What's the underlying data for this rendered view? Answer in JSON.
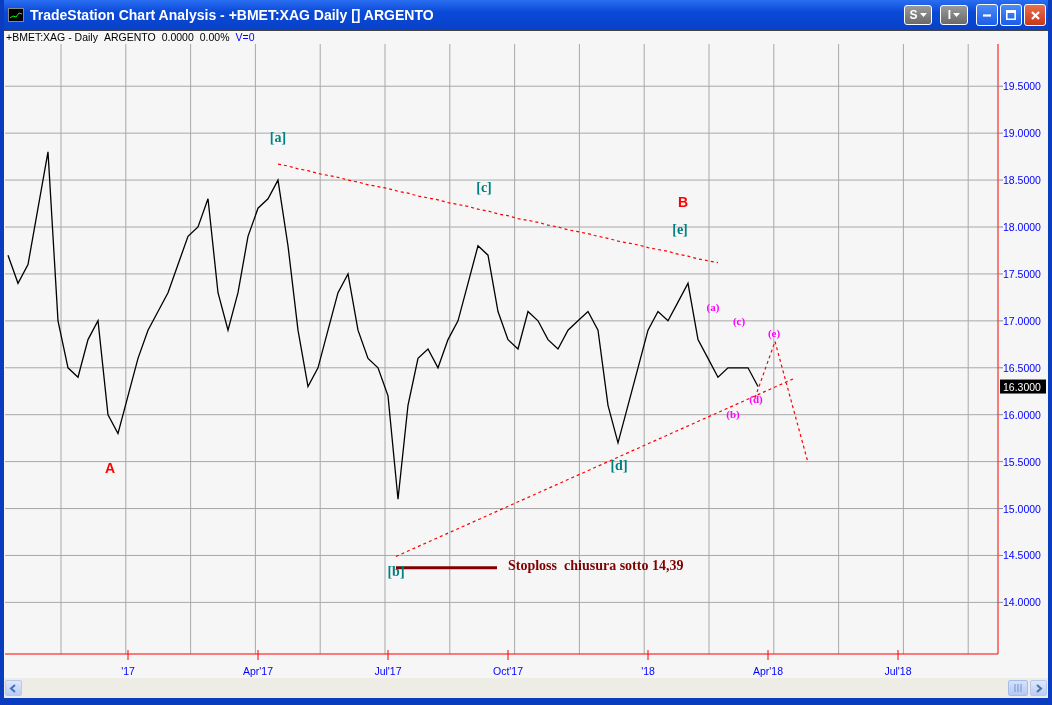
{
  "window": {
    "title": "TradeStation Chart Analysis - +BMET:XAG Daily [] ARGENTO",
    "toolbar_buttons": [
      "S",
      "I"
    ]
  },
  "chart_header": {
    "symbol": "+BMET:XAG - Daily",
    "name": "ARGENTO",
    "price": "0.0000",
    "change": "0.00%",
    "volume": "V=0"
  },
  "last_price": "16.3000",
  "chart_data": {
    "type": "line",
    "grid": true,
    "categories": [
      null,
      null,
      null,
      null,
      null,
      null,
      null,
      null,
      null,
      null,
      null,
      null,
      "'17",
      null,
      null,
      null,
      null,
      null,
      null,
      null,
      null,
      null,
      null,
      null,
      null,
      "Apr'17",
      null,
      null,
      null,
      null,
      null,
      null,
      null,
      null,
      null,
      null,
      null,
      null,
      "Jul'17",
      null,
      null,
      null,
      null,
      null,
      null,
      null,
      null,
      null,
      null,
      null,
      "Oct'17",
      null,
      null,
      null,
      null,
      null,
      null,
      null,
      null,
      null,
      null,
      null,
      null,
      null,
      "'18",
      null,
      null,
      null,
      null,
      null,
      null,
      null,
      null,
      null,
      null,
      null,
      "Apr'18",
      null,
      null,
      null,
      null,
      null,
      null,
      null,
      null,
      null,
      null,
      null,
      null,
      "Jul'18",
      null,
      null,
      null,
      null,
      null,
      null,
      null,
      null,
      null,
      null
    ],
    "series": [
      {
        "color": "#000000",
        "line_style": "solid",
        "values": [
          17.7,
          17.4,
          17.6,
          18.2,
          18.8,
          17.0,
          16.5,
          16.4,
          16.8,
          17.0,
          16.0,
          15.8,
          16.2,
          16.6,
          16.9,
          17.1,
          17.3,
          17.6,
          17.9,
          18.0,
          18.3,
          17.3,
          16.9,
          17.3,
          17.9,
          18.2,
          18.3,
          18.5,
          17.8,
          16.9,
          16.3,
          16.5,
          16.9,
          17.3,
          17.5,
          16.9,
          16.6,
          16.5,
          16.2,
          15.1,
          16.1,
          16.6,
          16.7,
          16.5,
          16.8,
          17.0,
          17.4,
          17.8,
          17.7,
          17.1,
          16.8,
          16.7,
          17.1,
          17.0,
          16.8,
          16.7,
          16.9,
          17.0,
          17.1,
          16.9,
          16.1,
          15.7,
          16.1,
          16.5,
          16.9,
          17.1,
          17.0,
          17.2,
          17.4,
          16.8,
          16.6,
          16.4,
          16.5,
          16.5,
          16.5,
          16.3,
          null,
          null,
          null,
          null,
          null,
          null,
          null,
          null,
          null,
          null,
          null,
          null,
          null,
          null,
          null,
          null,
          null,
          null,
          null,
          null,
          null,
          null,
          null,
          null
        ]
      },
      {
        "color": "#ff0000",
        "line_style": "dashed",
        "values": [
          null,
          null,
          null,
          null,
          null,
          null,
          null,
          null,
          null,
          null,
          null,
          null,
          null,
          null,
          null,
          null,
          null,
          null,
          null,
          null,
          null,
          null,
          null,
          null,
          null,
          null,
          null,
          18.67,
          18.65,
          18.62,
          18.6,
          18.57,
          18.55,
          18.53,
          18.5,
          18.48,
          18.45,
          18.43,
          18.41,
          18.38,
          18.36,
          18.33,
          18.31,
          18.29,
          18.26,
          18.24,
          18.22,
          18.19,
          18.17,
          18.14,
          18.12,
          18.09,
          18.07,
          18.05,
          18.02,
          18.0,
          17.97,
          17.95,
          17.93,
          17.9,
          17.88,
          17.85,
          17.83,
          17.81,
          17.78,
          17.76,
          17.74,
          17.71,
          17.69,
          17.66,
          17.64,
          17.62,
          null,
          null,
          null,
          null,
          null,
          null,
          null,
          null,
          null,
          null,
          null,
          null,
          null,
          null,
          null,
          null,
          null,
          null,
          null,
          null,
          null,
          null,
          null,
          null,
          null,
          null,
          null,
          null
        ]
      }
    ],
    "ylim": [
      13.45,
      19.95
    ],
    "yticks": [
      {
        "value": 14,
        "label": "14.0000"
      },
      {
        "value": 14.5,
        "label": "14.5000"
      },
      {
        "value": 15,
        "label": "15.0000"
      },
      {
        "value": 15.5,
        "label": "15.5000"
      },
      {
        "value": 16,
        "label": "16.0000"
      },
      {
        "value": 16.5,
        "label": "16.5000"
      },
      {
        "value": 17,
        "label": "17.0000"
      },
      {
        "value": 17.5,
        "label": "17.5000"
      },
      {
        "value": 18,
        "label": "18.0000"
      },
      {
        "value": 18.5,
        "label": "18.5000"
      },
      {
        "value": 19,
        "label": "19.0000"
      },
      {
        "value": 19.5,
        "label": "19.5000"
      }
    ],
    "annotations": [
      "A",
      "[a]",
      "[c]",
      "B",
      "[e]",
      "(a)",
      "(c)",
      "(e)",
      "(d)",
      "(b)",
      "[d]",
      "[b]",
      "Stoploss  chiusura sotto 14,39"
    ]
  }
}
